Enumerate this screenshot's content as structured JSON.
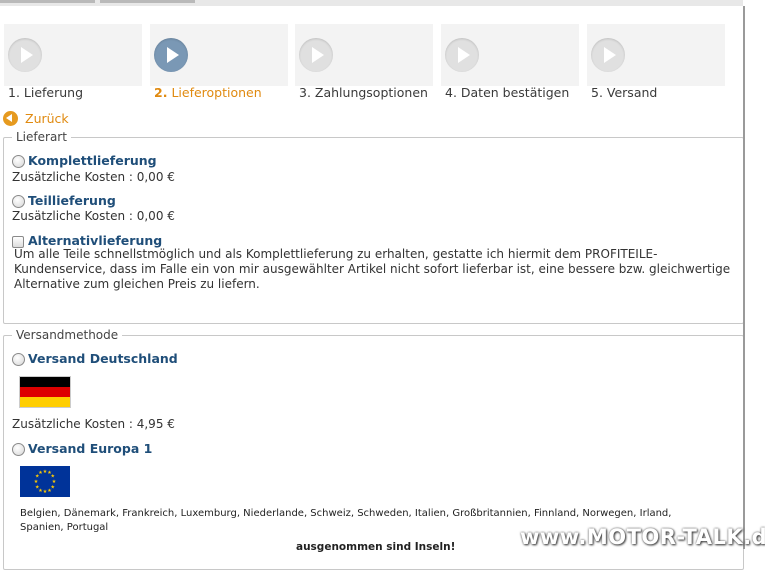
{
  "steps": [
    {
      "label": "1. Lieferung",
      "active": false
    },
    {
      "num": "2.",
      "text": "Lieferoptionen",
      "active": true
    },
    {
      "label": "3. Zahlungsoptionen",
      "active": false
    },
    {
      "label": "4. Daten bestätigen",
      "active": false
    },
    {
      "label": "5. Versand",
      "active": false
    }
  ],
  "back_label": "Zurück",
  "lieferart": {
    "legend": "Lieferart",
    "options": [
      {
        "title": "Komplettlieferung",
        "cost": "Zusätzliche Kosten : 0,00 €"
      },
      {
        "title": "Teillieferung",
        "cost": "Zusätzliche Kosten : 0,00 €"
      }
    ],
    "alternativ": {
      "title": "Alternativlieferung",
      "lines": [
        "Um alle Teile schnellstmöglich und als Komplettlieferung zu erhalten, gestatte ich hiermit dem PROFITEILE-",
        "Kundenservice, dass im Falle ein von mir ausgewählter Artikel nicht sofort lieferbar ist, eine bessere bzw. gleichwertige",
        "Alternative zum gleichen Preis zu liefern."
      ]
    }
  },
  "versandmethode": {
    "legend": "Versandmethode",
    "deutschland": {
      "title": "Versand Deutschland",
      "flag": "germany-flag",
      "cost": "Zusätzliche Kosten : 4,95 €"
    },
    "europa": {
      "title": "Versand Europa 1",
      "flag": "eu-flag",
      "countries_line1": "Belgien, Dänemark, Frankreich, Luxemburg, Niederlande, Schweiz, Schweden, Italien, Großbritannien, Finnland, Norwegen, Irland,",
      "countries_line2": "Spanien, Portugal",
      "note": "ausgenommen sind Inseln!"
    }
  },
  "watermark": "www.MOTOR-TALK.de",
  "colors": {
    "accent": "#e08a10",
    "title_blue": "#1f4e79",
    "active_circle": "#7a98b5"
  }
}
